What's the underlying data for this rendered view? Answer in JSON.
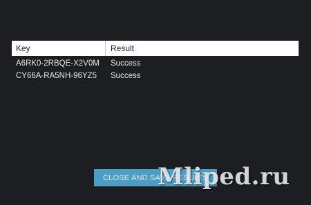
{
  "table": {
    "headers": {
      "key": "Key",
      "result": "Result"
    },
    "rows": [
      {
        "key": "A6RK0-2RBQE-X2V0M",
        "result": "Success"
      },
      {
        "key": "CY66A-RA5NH-96YZ5",
        "result": "Success"
      }
    ]
  },
  "actions": {
    "close_label": "CLOSE AND SAVE RESULTS"
  },
  "watermark": {
    "text": "Mliped.ru"
  },
  "colors": {
    "background": "#1c1e21",
    "accent": "#4d9ec5"
  }
}
